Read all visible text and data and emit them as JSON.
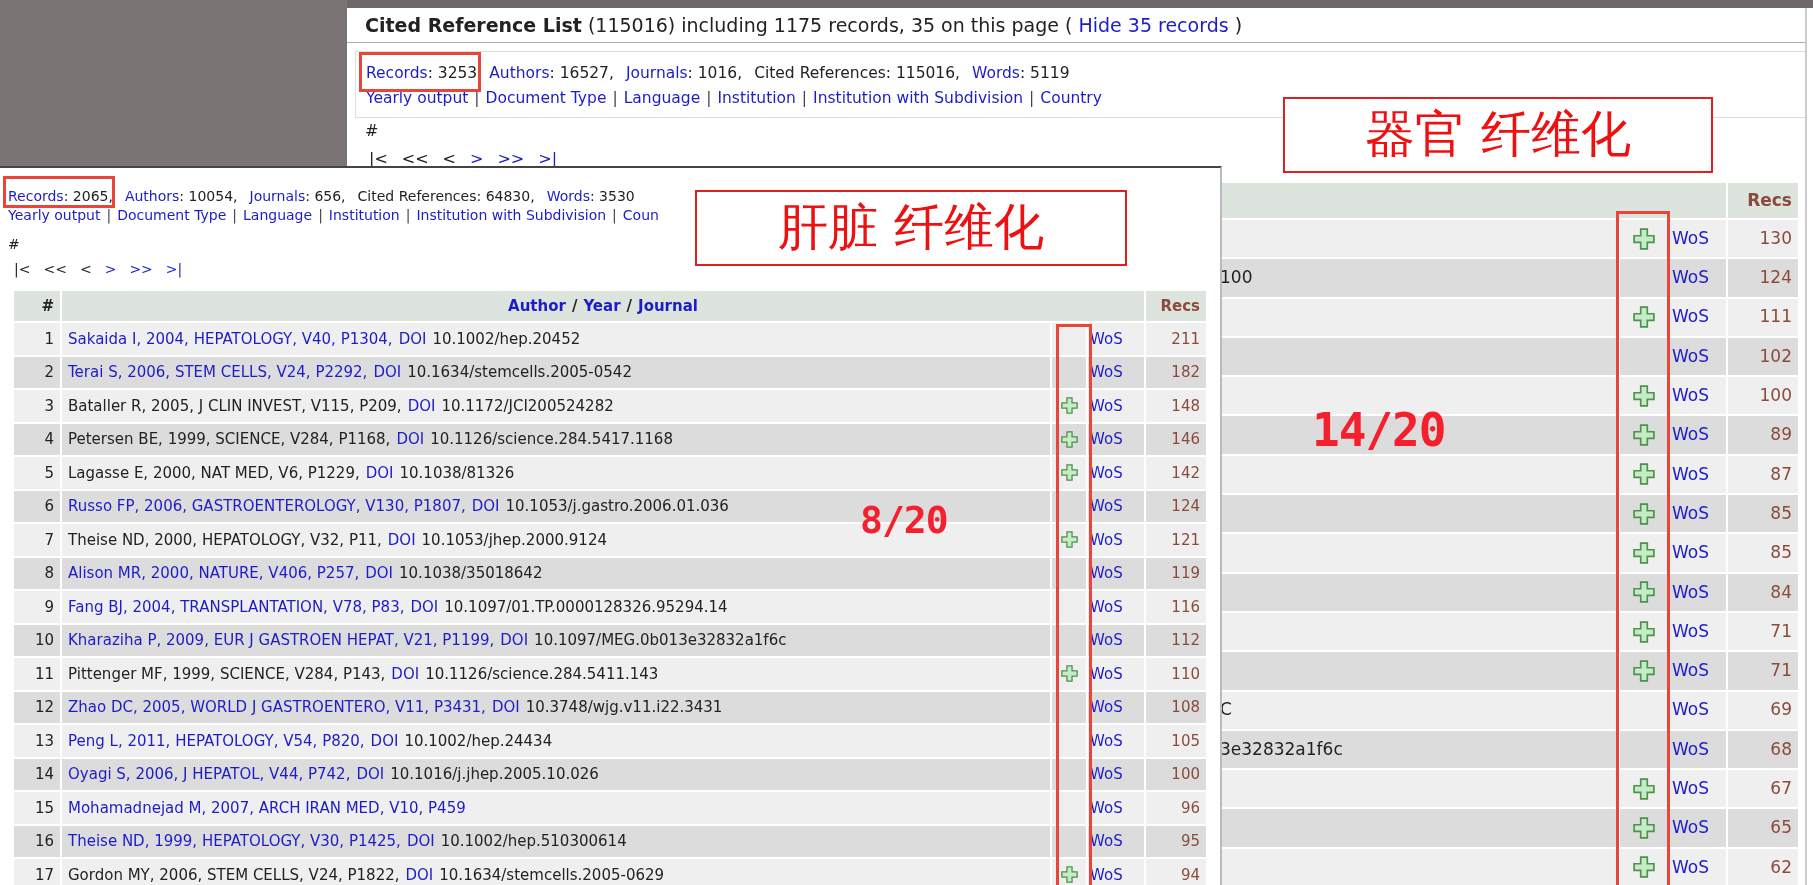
{
  "back_page": {
    "title": {
      "heading": "Cited Reference List",
      "text": "(115016) including 1175 records, 35 on this page (",
      "link": "Hide 35 records",
      "end": ")"
    },
    "stats": [
      {
        "label": "Records",
        "value": ": 3253",
        "linked": true
      },
      {
        "label": "Authors",
        "value": ": 16527,",
        "linked": true
      },
      {
        "label": "Journals",
        "value": ": 1016,",
        "linked": true
      },
      {
        "label": "Cited References",
        "value": ": 115016,",
        "linked": false
      },
      {
        "label": "Words",
        "value": ": 5119",
        "linked": true
      }
    ],
    "separator": "|",
    "views": [
      "Yearly output",
      "Document Type",
      "Language",
      "Institution",
      "Institution with Subdivision",
      "Country"
    ],
    "hash": "#",
    "pager": [
      {
        "text": "|<",
        "enabled": false
      },
      {
        "text": "<<",
        "enabled": false
      },
      {
        "text": "<",
        "enabled": false
      },
      {
        "text": ">",
        "enabled": true
      },
      {
        "text": ">>",
        "enabled": true
      },
      {
        "text": ">|",
        "enabled": true
      }
    ],
    "table": {
      "recs_header": "Recs",
      "rows": [
        {
          "fragment": "",
          "plus": true,
          "wos": "WoS",
          "recs": "130"
        },
        {
          "fragment": "100",
          "plus": false,
          "wos": "WoS",
          "recs": "124"
        },
        {
          "fragment": "",
          "plus": true,
          "wos": "WoS",
          "recs": "111"
        },
        {
          "fragment": "",
          "plus": false,
          "wos": "WoS",
          "recs": "102"
        },
        {
          "fragment": "",
          "plus": true,
          "wos": "WoS",
          "recs": "100"
        },
        {
          "fragment": "",
          "plus": true,
          "wos": "WoS",
          "recs": "89"
        },
        {
          "fragment": "",
          "plus": true,
          "wos": "WoS",
          "recs": "87"
        },
        {
          "fragment": "",
          "plus": true,
          "wos": "WoS",
          "recs": "85"
        },
        {
          "fragment": "",
          "plus": true,
          "wos": "WoS",
          "recs": "85"
        },
        {
          "fragment": "",
          "plus": true,
          "wos": "WoS",
          "recs": "84"
        },
        {
          "fragment": "",
          "plus": true,
          "wos": "WoS",
          "recs": "71"
        },
        {
          "fragment": "",
          "plus": true,
          "wos": "WoS",
          "recs": "71"
        },
        {
          "fragment": "C",
          "plus": false,
          "wos": "WoS",
          "recs": "69"
        },
        {
          "fragment": "3e32832a1f6c",
          "plus": false,
          "wos": "WoS",
          "recs": "68"
        },
        {
          "fragment": "",
          "plus": true,
          "wos": "WoS",
          "recs": "67"
        },
        {
          "fragment": "",
          "plus": true,
          "wos": "WoS",
          "recs": "65"
        },
        {
          "fragment": "",
          "plus": true,
          "wos": "WoS",
          "recs": "62"
        }
      ]
    }
  },
  "front_page": {
    "stats": [
      {
        "label": "Records",
        "value": ": 2065,",
        "linked": true
      },
      {
        "label": "Authors",
        "value": ": 10054,",
        "linked": true
      },
      {
        "label": "Journals",
        "value": ": 656,",
        "linked": true
      },
      {
        "label": "Cited References",
        "value": ": 64830,",
        "linked": false
      },
      {
        "label": "Words",
        "value": ": 3530",
        "linked": true
      }
    ],
    "separator": "|",
    "views": [
      "Yearly output",
      "Document Type",
      "Language",
      "Institution",
      "Institution with Subdivision",
      "Coun"
    ],
    "hash": "#",
    "pager": [
      {
        "text": "|<",
        "enabled": false
      },
      {
        "text": "<<",
        "enabled": false
      },
      {
        "text": "<",
        "enabled": false
      },
      {
        "text": ">",
        "enabled": true
      },
      {
        "text": ">>",
        "enabled": true
      },
      {
        "text": ">|",
        "enabled": true
      }
    ],
    "table": {
      "columns": {
        "number": "#",
        "author": "Author",
        "year": "Year",
        "journal": "Journal",
        "slash": "/",
        "recs": "Recs"
      },
      "rows": [
        {
          "number": "1",
          "citation": "Sakaida I, 2004, HEPATOLOGY, V40, P1304,",
          "linked": true,
          "doi_label": "DOI",
          "doi": "10.1002/hep.20452",
          "plus": false,
          "wos": "WoS",
          "recs": "211"
        },
        {
          "number": "2",
          "citation": "Terai S, 2006, STEM CELLS, V24, P2292,",
          "linked": true,
          "doi_label": "DOI",
          "doi": "10.1634/stemcells.2005-0542",
          "plus": false,
          "wos": "WoS",
          "recs": "182"
        },
        {
          "number": "3",
          "citation": "Bataller R, 2005, J CLIN INVEST, V115, P209,",
          "linked": false,
          "doi_label": "DOI",
          "doi": "10.1172/JCI200524282",
          "plus": true,
          "wos": "WoS",
          "recs": "148"
        },
        {
          "number": "4",
          "citation": "Petersen BE, 1999, SCIENCE, V284, P1168,",
          "linked": false,
          "doi_label": "DOI",
          "doi": "10.1126/science.284.5417.1168",
          "plus": true,
          "wos": "WoS",
          "recs": "146"
        },
        {
          "number": "5",
          "citation": "Lagasse E, 2000, NAT MED, V6, P1229,",
          "linked": false,
          "doi_label": "DOI",
          "doi": "10.1038/81326",
          "plus": true,
          "wos": "WoS",
          "recs": "142"
        },
        {
          "number": "6",
          "citation": "Russo FP, 2006, GASTROENTEROLOGY, V130, P1807,",
          "linked": true,
          "doi_label": "DOI",
          "doi": "10.1053/j.gastro.2006.01.036",
          "plus": false,
          "wos": "WoS",
          "recs": "124"
        },
        {
          "number": "7",
          "citation": "Theise ND, 2000, HEPATOLOGY, V32, P11,",
          "linked": false,
          "doi_label": "DOI",
          "doi": "10.1053/jhep.2000.9124",
          "plus": true,
          "wos": "WoS",
          "recs": "121"
        },
        {
          "number": "8",
          "citation": "Alison MR, 2000, NATURE, V406, P257,",
          "linked": true,
          "doi_label": "DOI",
          "doi": "10.1038/35018642",
          "plus": false,
          "wos": "WoS",
          "recs": "119"
        },
        {
          "number": "9",
          "citation": "Fang BJ, 2004, TRANSPLANTATION, V78, P83,",
          "linked": true,
          "doi_label": "DOI",
          "doi": "10.1097/01.TP.0000128326.95294.14",
          "plus": false,
          "wos": "WoS",
          "recs": "116"
        },
        {
          "number": "10",
          "citation": "Kharaziha P, 2009, EUR J GASTROEN HEPAT, V21, P1199,",
          "linked": true,
          "doi_label": "DOI",
          "doi": "10.1097/MEG.0b013e32832a1f6c",
          "plus": false,
          "wos": "WoS",
          "recs": "112"
        },
        {
          "number": "11",
          "citation": "Pittenger MF, 1999, SCIENCE, V284, P143,",
          "linked": false,
          "doi_label": "DOI",
          "doi": "10.1126/science.284.5411.143",
          "plus": true,
          "wos": "WoS",
          "recs": "110"
        },
        {
          "number": "12",
          "citation": "Zhao DC, 2005, WORLD J GASTROENTERO, V11, P3431,",
          "linked": true,
          "doi_label": "DOI",
          "doi": "10.3748/wjg.v11.i22.3431",
          "plus": false,
          "wos": "WoS",
          "recs": "108"
        },
        {
          "number": "13",
          "citation": "Peng L, 2011, HEPATOLOGY, V54, P820,",
          "linked": true,
          "doi_label": "DOI",
          "doi": "10.1002/hep.24434",
          "plus": false,
          "wos": "WoS",
          "recs": "105"
        },
        {
          "number": "14",
          "citation": "Oyagi S, 2006, J HEPATOL, V44, P742,",
          "linked": true,
          "doi_label": "DOI",
          "doi": "10.1016/j.jhep.2005.10.026",
          "plus": false,
          "wos": "WoS",
          "recs": "100"
        },
        {
          "number": "15",
          "citation": "Mohamadnejad M, 2007, ARCH IRAN MED, V10, P459",
          "linked": true,
          "plus": false,
          "wos": "WoS",
          "recs": "96"
        },
        {
          "number": "16",
          "citation": "Theise ND, 1999, HEPATOLOGY, V30, P1425,",
          "linked": true,
          "doi_label": "DOI",
          "doi": "10.1002/hep.510300614",
          "plus": false,
          "wos": "WoS",
          "recs": "95"
        },
        {
          "number": "17",
          "citation": "Gordon MY, 2006, STEM CELLS, V24, P1822,",
          "linked": false,
          "doi_label": "DOI",
          "doi": "10.1634/stemcells.2005-0629",
          "plus": true,
          "wos": "WoS",
          "recs": "94"
        }
      ]
    }
  },
  "annotations": [
    {
      "kind": "label",
      "text": "器官 纤维化"
    },
    {
      "kind": "label",
      "text": "肝脏 纤维化"
    },
    {
      "kind": "score",
      "text": "14/20"
    },
    {
      "kind": "score",
      "text": "8/20"
    }
  ]
}
